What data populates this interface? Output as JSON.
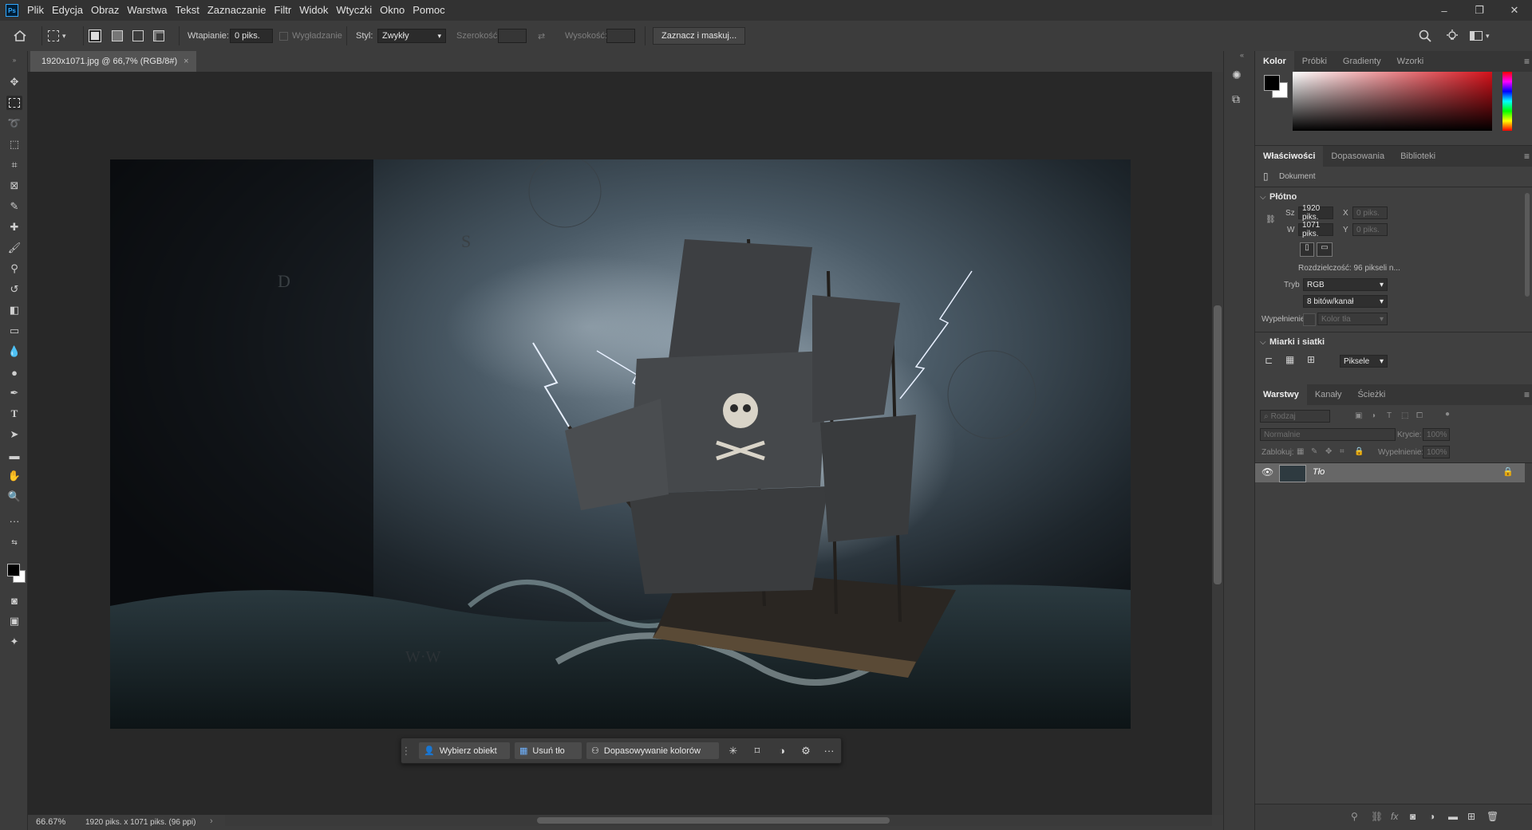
{
  "app": {
    "logo": "Ps"
  },
  "menu": [
    "Plik",
    "Edycja",
    "Obraz",
    "Warstwa",
    "Tekst",
    "Zaznaczanie",
    "Filtr",
    "Widok",
    "Wtyczki",
    "Okno",
    "Pomoc"
  ],
  "window_controls": {
    "minimize": "–",
    "restore": "❐",
    "close": "✕"
  },
  "options": {
    "feather_label": "Wtapianie:",
    "feather_value": "0 piks.",
    "antialias_label": "Wygładzanie",
    "style_label": "Styl:",
    "style_value": "Zwykły",
    "width_label": "Szerokość:",
    "height_label": "Wysokość:",
    "mask_button": "Zaznacz i maskuj..."
  },
  "document": {
    "tab_title": "1920x1071.jpg @ 66,7% (RGB/8#)",
    "zoom": "66.67%",
    "info": "1920 piks. x 1071 piks. (96 ppi)"
  },
  "taskbar": {
    "select_subject": "Wybierz obiekt",
    "remove_bg": "Usuń tło",
    "color_match": "Dopasowywanie kolorów"
  },
  "color_panel": {
    "tabs": [
      "Kolor",
      "Próbki",
      "Gradienty",
      "Wzorki"
    ],
    "fg": "#000000",
    "bg": "#ffffff",
    "hue": "#d4111a"
  },
  "properties": {
    "tabs": [
      "Właściwości",
      "Dopasowania",
      "Biblioteki"
    ],
    "doc_label": "Dokument",
    "canvas_head": "Płótno",
    "w_label": "Sz",
    "w_value": "1920 piks.",
    "h_label": "W",
    "h_value": "1071 piks.",
    "x_label": "X",
    "x_placeholder": "0 piks.",
    "y_label": "Y",
    "y_placeholder": "0 piks.",
    "resolution": "Rozdzielczość: 96 pikseli n...",
    "mode_label": "Tryb",
    "mode_value": "RGB",
    "bits_value": "8 bitów/kanał",
    "fill_label": "Wypełnienie",
    "fill_value": "Kolor tła",
    "rulers_head": "Miarki i siatki",
    "units_value": "Piksele"
  },
  "layers": {
    "tabs": [
      "Warstwy",
      "Kanały",
      "Ścieżki"
    ],
    "filter_placeholder": "Rodzaj",
    "blend_mode": "Normalnie",
    "opacity_label": "Krycie:",
    "opacity_value": "100%",
    "lock_label": "Zablokuj:",
    "fill_label": "Wypełnienie:",
    "fill_value": "100%",
    "items": [
      {
        "name": "Tło"
      }
    ]
  }
}
